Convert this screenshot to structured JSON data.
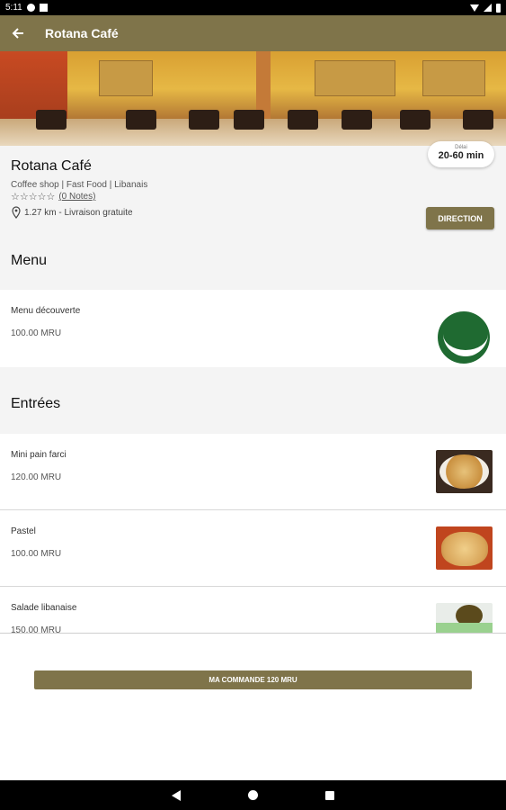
{
  "status_bar": {
    "time": "5:11"
  },
  "app_bar": {
    "title": "Rotana Café"
  },
  "restaurant": {
    "time_label": "Délai",
    "time_value": "20-60 min",
    "name": "Rotana Café",
    "categories": "Coffee shop | Fast Food | Libanais",
    "stars": "☆☆☆☆☆",
    "notes": "(0 Notes)",
    "delivery": "1.27 km - Livraison gratuite",
    "direction_label": "DIRECTION"
  },
  "sections": [
    {
      "title": "Menu",
      "items": [
        {
          "name": "Menu découverte",
          "price": "100.00 MRU",
          "image_icon": "restaurant-logo"
        }
      ]
    },
    {
      "title": "Entrées",
      "items": [
        {
          "name": "Mini pain farci",
          "price": "120.00 MRU",
          "image_icon": "stuffed-bread-photo"
        },
        {
          "name": "Pastel",
          "price": "100.00 MRU",
          "image_icon": "pastel-photo"
        },
        {
          "name": "Salade libanaise",
          "price": "150.00 MRU",
          "image_icon": "salad-photo"
        }
      ]
    }
  ],
  "order_button": "MA COMMANDE 120 MRU",
  "colors": {
    "brand": "#7f744a",
    "section_bg": "#f4f4f4"
  }
}
